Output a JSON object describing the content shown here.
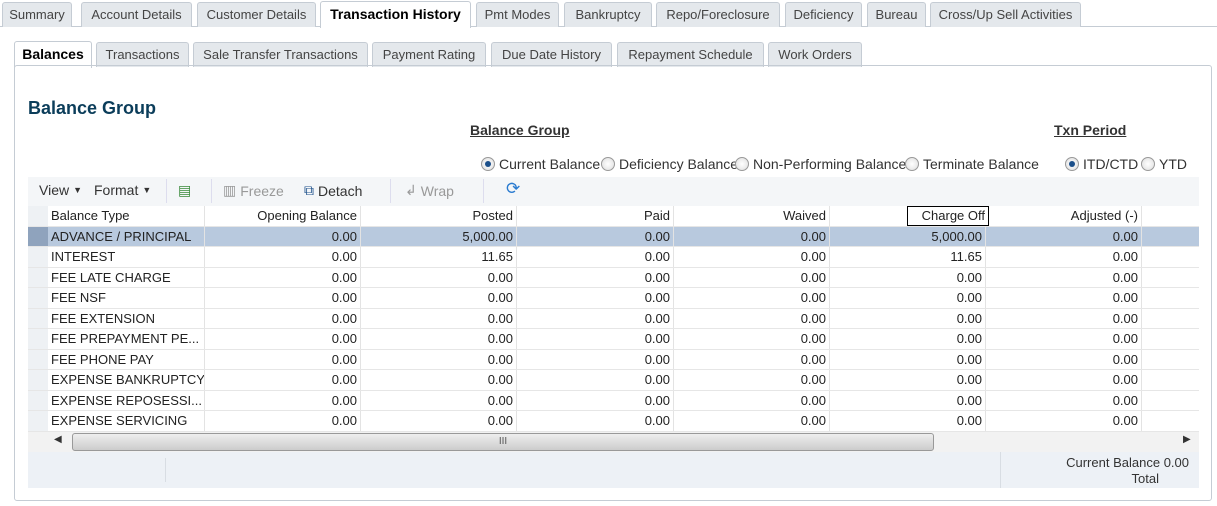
{
  "main_tabs": [
    "Summary",
    "Account Details",
    "Customer Details",
    "Transaction History",
    "Pmt Modes",
    "Bankruptcy",
    "Repo/Foreclosure",
    "Deficiency",
    "Bureau",
    "Cross/Up Sell Activities"
  ],
  "sub_tabs": [
    "Balances",
    "Transactions",
    "Sale Transfer Transactions",
    "Payment Rating",
    "Due Date History",
    "Repayment Schedule",
    "Work Orders"
  ],
  "section_title": "Balance Group",
  "balance_group": {
    "label": "Balance Group",
    "options": [
      "Current Balance",
      "Deficiency Balance",
      "Non-Performing Balance",
      "Terminate Balance"
    ],
    "selected": "Current Balance"
  },
  "txn_period": {
    "label": "Txn Period",
    "options": [
      "ITD/CTD",
      "YTD"
    ],
    "selected": "ITD/CTD"
  },
  "toolbar": {
    "view": "View",
    "format": "Format",
    "freeze": "Freeze",
    "detach": "Detach",
    "wrap": "Wrap"
  },
  "table": {
    "columns": [
      "Balance Type",
      "Opening Balance",
      "Posted",
      "Paid",
      "Waived",
      "Charge Off",
      "Adjusted (-)"
    ],
    "rows": [
      [
        "ADVANCE / PRINCIPAL",
        "0.00",
        "5,000.00",
        "0.00",
        "0.00",
        "5,000.00",
        "0.00"
      ],
      [
        "INTEREST",
        "0.00",
        "11.65",
        "0.00",
        "0.00",
        "11.65",
        "0.00"
      ],
      [
        "FEE LATE CHARGE",
        "0.00",
        "0.00",
        "0.00",
        "0.00",
        "0.00",
        "0.00"
      ],
      [
        "FEE NSF",
        "0.00",
        "0.00",
        "0.00",
        "0.00",
        "0.00",
        "0.00"
      ],
      [
        "FEE EXTENSION",
        "0.00",
        "0.00",
        "0.00",
        "0.00",
        "0.00",
        "0.00"
      ],
      [
        "FEE PREPAYMENT PE...",
        "0.00",
        "0.00",
        "0.00",
        "0.00",
        "0.00",
        "0.00"
      ],
      [
        "FEE PHONE PAY",
        "0.00",
        "0.00",
        "0.00",
        "0.00",
        "0.00",
        "0.00"
      ],
      [
        "EXPENSE BANKRUPTCY",
        "0.00",
        "0.00",
        "0.00",
        "0.00",
        "0.00",
        "0.00"
      ],
      [
        "EXPENSE REPOSESSI...",
        "0.00",
        "0.00",
        "0.00",
        "0.00",
        "0.00",
        "0.00"
      ],
      [
        "EXPENSE SERVICING",
        "0.00",
        "0.00",
        "0.00",
        "0.00",
        "0.00",
        "0.00"
      ]
    ]
  },
  "footer": {
    "label": "Current Balance",
    "value": "0.00",
    "label2": "Total"
  }
}
